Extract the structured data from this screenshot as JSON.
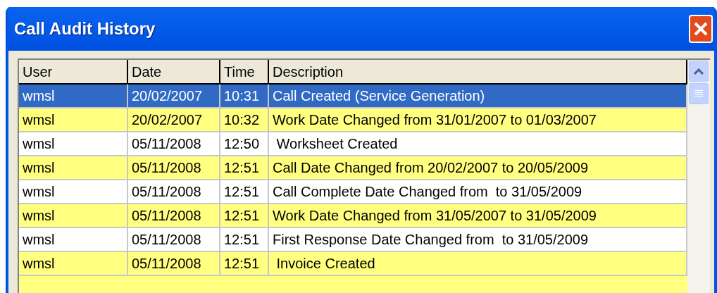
{
  "window": {
    "title": "Call Audit History"
  },
  "table": {
    "columns": [
      "User",
      "Date",
      "Time",
      "Description"
    ],
    "rows": [
      {
        "cells": [
          "wmsl",
          "20/02/2007",
          "10:31",
          "Call Created (Service Generation)"
        ],
        "selected": true
      },
      {
        "cells": [
          "wmsl",
          "20/02/2007",
          "10:32",
          "Work Date Changed from 31/01/2007 to 01/03/2007"
        ],
        "selected": false,
        "highlighted": true
      },
      {
        "cells": [
          "wmsl",
          "05/11/2008",
          "12:50",
          " Worksheet Created"
        ],
        "selected": false,
        "highlighted": false
      },
      {
        "cells": [
          "wmsl",
          "05/11/2008",
          "12:51",
          "Call Date Changed from 20/02/2007 to 20/05/2009"
        ],
        "selected": false,
        "highlighted": true
      },
      {
        "cells": [
          "wmsl",
          "05/11/2008",
          "12:51",
          "Call Complete Date Changed from  to 31/05/2009"
        ],
        "selected": false,
        "highlighted": false
      },
      {
        "cells": [
          "wmsl",
          "05/11/2008",
          "12:51",
          "Work Date Changed from 31/05/2007 to 31/05/2009"
        ],
        "selected": false,
        "highlighted": true
      },
      {
        "cells": [
          "wmsl",
          "05/11/2008",
          "12:51",
          "First Response Date Changed from  to 31/05/2009"
        ],
        "selected": false,
        "highlighted": false
      },
      {
        "cells": [
          "wmsl",
          "05/11/2008",
          "12:51",
          " Invoice Created"
        ],
        "selected": false,
        "highlighted": true
      }
    ]
  }
}
